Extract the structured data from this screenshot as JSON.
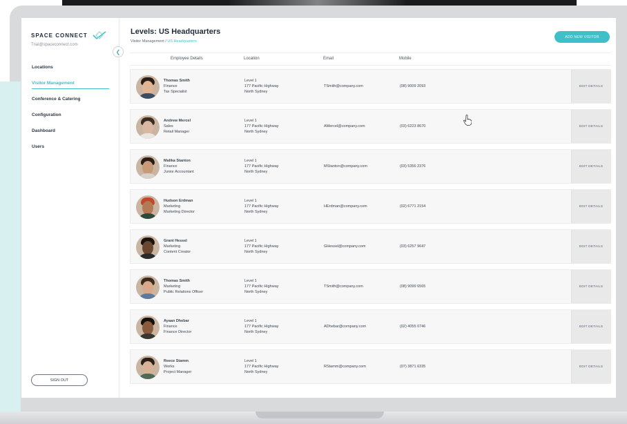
{
  "brand": {
    "name": "SPACE CONNECT",
    "account_email": "Trial@spaceconnect.com",
    "accent_color": "#3fc0c9"
  },
  "sidebar": {
    "collapse_icon": "chevron-left-icon",
    "items": [
      {
        "label": "Locations"
      },
      {
        "label": "Visitor Management",
        "active": true
      },
      {
        "label": "Conference & Catering"
      },
      {
        "label": "Configuration"
      },
      {
        "label": "Dashboard"
      },
      {
        "label": "Users"
      }
    ],
    "sign_out_label": "SIGN OUT"
  },
  "header": {
    "title": "Levels: US Headquarters",
    "breadcrumb": {
      "root": "Visitor Management",
      "separator": "/",
      "current": "US Headquarters"
    },
    "add_button_label": "ADD NEW VISITOR"
  },
  "table": {
    "columns": [
      "Employee Details",
      "Location",
      "Email",
      "Mobile"
    ],
    "edit_label": "EDIT DETAILS",
    "rows": [
      {
        "name": "Thomas Smith",
        "department": "Finance",
        "role": "Tax Specialist",
        "level": "Level 1",
        "address": "177 Pacific Highway",
        "suburb": "North Sydney",
        "email": "TSmith@company.com",
        "mobile": "(08) 9009 2093",
        "avatar": {
          "skin": "#e0b595",
          "hair": "#2a1d15",
          "shirt": "#3c4e63"
        }
      },
      {
        "name": "Andrew Mercel",
        "department": "Sales",
        "role": "Retail Manager",
        "level": "Level 1",
        "address": "177 Pacific Highway",
        "suburb": "North Sydney",
        "email": "AMercel@company.com",
        "mobile": "(03) 6223 8670",
        "avatar": {
          "skin": "#d9b7a0",
          "hair": "#3a2c22",
          "shirt": "#e9e6e2"
        }
      },
      {
        "name": "Malika Stanton",
        "department": "Finance",
        "role": "Junior Accountant",
        "level": "Level 1",
        "address": "177 Pacific Highway",
        "suburb": "North Sydney",
        "email": "MStanton@company.com",
        "mobile": "(03) 5356 2376",
        "avatar": {
          "skin": "#c99a78",
          "hair": "#2b1c14",
          "shirt": "#d7d2cc"
        }
      },
      {
        "name": "Hudson Erdman",
        "department": "Marketing",
        "role": "Marketing Director",
        "level": "Level 1",
        "address": "177 Pacific Highway",
        "suburb": "North Sydney",
        "email": "HErdman@company.com",
        "mobile": "(02) 6771 2154",
        "avatar": {
          "skin": "#b27a55",
          "hair": "#c2472b",
          "shirt": "#2d4a3a"
        }
      },
      {
        "name": "Grant Hessel",
        "department": "Marketing",
        "role": "Content Creator",
        "level": "Level 1",
        "address": "177 Pacific Highway",
        "suburb": "North Sydney",
        "email": "GHessel@company.com",
        "mobile": "(03) 6257 9647",
        "avatar": {
          "skin": "#6b4630",
          "hair": "#1a120d",
          "shirt": "#2a2a2a"
        }
      },
      {
        "name": "Thomas Smith",
        "department": "Marketing",
        "role": "Public Relations Officer",
        "level": "Level 1",
        "address": "177 Pacific Highway",
        "suburb": "North Sydney",
        "email": "TSmith@company.com",
        "mobile": "(08) 9099 6565",
        "avatar": {
          "skin": "#d8a98a",
          "hair": "#3b2a1e",
          "shirt": "#5c7aa0"
        }
      },
      {
        "name": "Ayaan Dhebar",
        "department": "Finance",
        "role": "Finance Director",
        "level": "Level 1",
        "address": "177 Pacific Highway",
        "suburb": "North Sydney",
        "email": "ADhebar@company.com",
        "mobile": "(02) 4055 0746",
        "avatar": {
          "skin": "#8a5a3c",
          "hair": "#15100c",
          "shirt": "#3a3530"
        }
      },
      {
        "name": "Reece Stamm",
        "department": "Works",
        "role": "Project Manager",
        "level": "Level 1",
        "address": "177 Pacific Highway",
        "suburb": "North Sydney",
        "email": "RStamm@company.com",
        "mobile": "(07) 3871 6335",
        "avatar": {
          "skin": "#d7b296",
          "hair": "#2b2019",
          "shirt": "#4f6b55"
        }
      }
    ]
  }
}
